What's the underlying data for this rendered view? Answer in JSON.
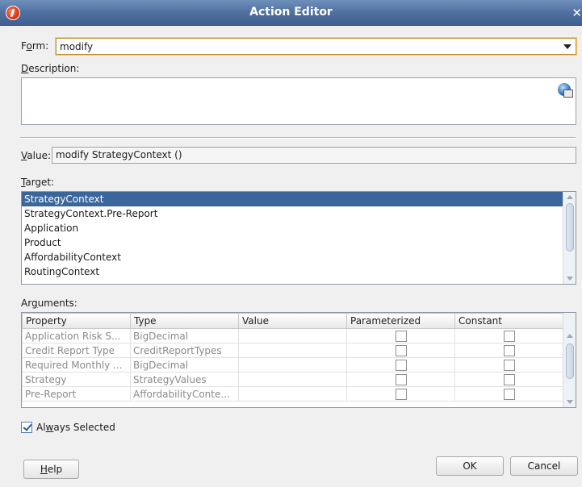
{
  "window": {
    "title": "Action Editor",
    "icon": "app-logo-icon",
    "close_icon": "close-icon"
  },
  "form": {
    "label_pre": "F",
    "label_mn": "o",
    "label_post": "rm:",
    "value": "modify"
  },
  "description": {
    "label_mn": "D",
    "label_post": "escription:",
    "value": "",
    "icon": "globe-edit-icon"
  },
  "value": {
    "label_mn": "V",
    "label_post": "alue:",
    "text": "modify StrategyContext ()"
  },
  "target": {
    "label_mn": "T",
    "label_post": "arget:",
    "items": [
      "StrategyContext",
      "StrategyContext.Pre-Report",
      "Application",
      "Product",
      "AffordabilityContext",
      "RoutingContext"
    ],
    "selected_index": 0
  },
  "arguments": {
    "label_pre": "Ar",
    "label_mn": "g",
    "label_post": "uments:",
    "columns": [
      "Property",
      "Type",
      "Value",
      "Parameterized",
      "Constant"
    ],
    "rows": [
      {
        "property": "Application Risk S...",
        "type": "BigDecimal",
        "value": "",
        "parameterized": false,
        "constant": false
      },
      {
        "property": "Credit Report Type",
        "type": "CreditReportTypes",
        "value": "",
        "parameterized": false,
        "constant": false
      },
      {
        "property": "Required Monthly ...",
        "type": "BigDecimal",
        "value": "",
        "parameterized": false,
        "constant": false
      },
      {
        "property": "Strategy",
        "type": "StrategyValues",
        "value": "",
        "parameterized": false,
        "constant": false
      },
      {
        "property": "Pre-Report",
        "type": "AffordabilityConte...",
        "value": "",
        "parameterized": false,
        "constant": false
      }
    ]
  },
  "always_selected": {
    "label_pre": "Al",
    "label_mn": "w",
    "label_post": "ays Selected",
    "checked": true
  },
  "buttons": {
    "help_mn": "H",
    "help_post": "elp",
    "ok": "OK",
    "cancel": "Cancel"
  },
  "colors": {
    "titlebar": "#4d6e9e",
    "selection": "#3a669c",
    "focus_border": "#c58f2f"
  }
}
